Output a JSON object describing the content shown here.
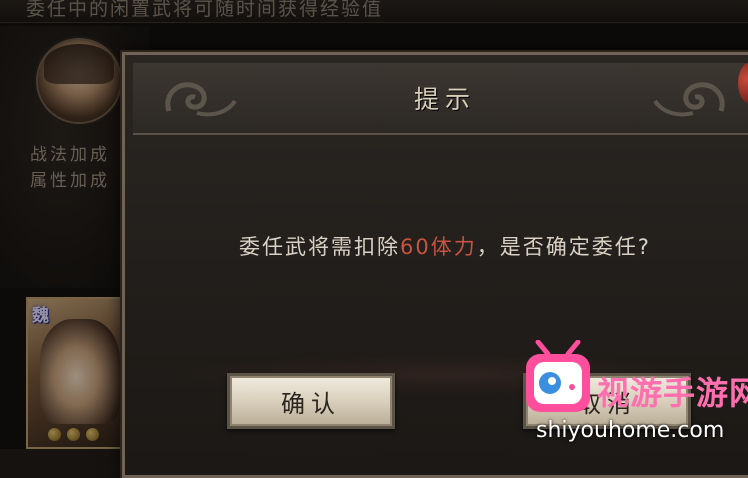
{
  "background": {
    "top_text": "委任中的闲置武将可随时间获得经验值",
    "bonus_lines": [
      "战法加成",
      "属性加成"
    ],
    "card_faction": "魏"
  },
  "dialog": {
    "title": "提示",
    "message_prefix": "委任武将需扣除",
    "message_cost": "60体力",
    "message_suffix": "，是否确定委任?",
    "confirm_label": "确认",
    "cancel_label": "取消"
  },
  "watermark": {
    "brand": "视游手游网",
    "url": "shiyouhome.com"
  },
  "colors": {
    "cost_highlight": "#c8533f",
    "dialog_bg": "#221e1b",
    "button_face": "#e3dbc9",
    "watermark_pink": "#ff6fb0"
  }
}
